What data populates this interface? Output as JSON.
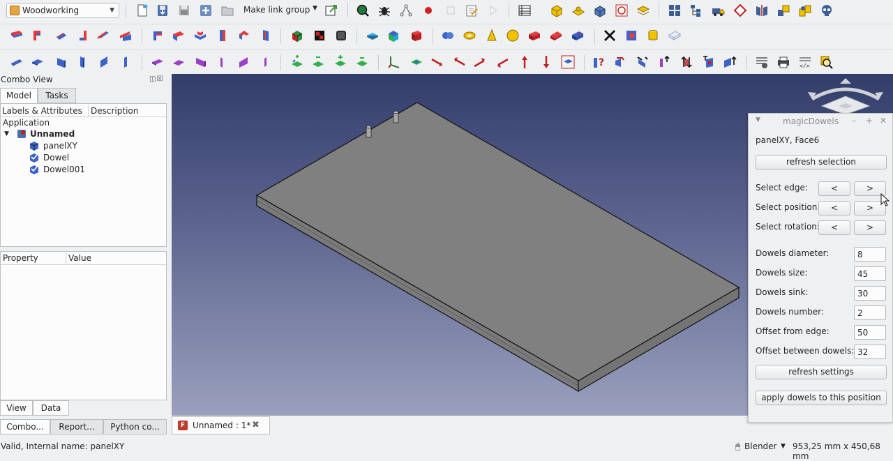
{
  "toolbar": {
    "workbench": "Woodworking",
    "make_link_group": "Make link group"
  },
  "combo_view": {
    "title": "Combo View",
    "tabs": [
      "Model",
      "Tasks"
    ],
    "tree_columns": [
      "Labels & Attributes",
      "Description"
    ],
    "tree": {
      "root": "Application",
      "document": "Unnamed",
      "items": [
        "panelXY",
        "Dowel",
        "Dowel001"
      ]
    },
    "property_columns": [
      "Property",
      "Value"
    ],
    "view_tabs": [
      "View",
      "Data"
    ],
    "bottom_tabs": [
      "Combo...",
      "Report...",
      "Python co..."
    ]
  },
  "document_tab": {
    "label": "Unnamed : 1*"
  },
  "magic_dowels": {
    "title": "magicDowels",
    "selection": "panelXY, Face6",
    "refresh_selection": "refresh selection",
    "select_edge": "Select edge:",
    "select_position": "Select position:",
    "select_rotation": "Select rotation:",
    "prev": "<",
    "next": ">",
    "fields": [
      {
        "label": "Dowels diameter:",
        "value": "8"
      },
      {
        "label": "Dowels size:",
        "value": "45"
      },
      {
        "label": "Dowels sink:",
        "value": "30"
      },
      {
        "label": "Dowels number:",
        "value": "2"
      },
      {
        "label": "Offset from edge:",
        "value": "50"
      },
      {
        "label": "Offset between dowels:",
        "value": "32"
      }
    ],
    "refresh_settings": "refresh settings",
    "apply": "apply dowels to this position"
  },
  "status": {
    "message": "Valid, Internal name: panelXY",
    "navigation": "Blender",
    "dimensions": "953,25 mm x 450,68 mm"
  },
  "colors": {
    "viewport_top": "#333d6a",
    "viewport_bottom": "#9aa0bd",
    "panel": "#eff0f1",
    "model_face": "#808080"
  }
}
